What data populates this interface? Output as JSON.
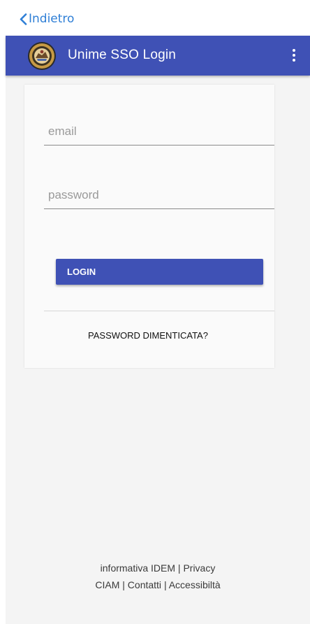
{
  "nav": {
    "back_label": "Indietro",
    "accent": "#2f7fd6"
  },
  "appbar": {
    "title": "Unime SSO Login",
    "background": "#3f51b5",
    "logo_icon": "university-seal-icon",
    "menu_icon": "more-vert-icon"
  },
  "form": {
    "email": {
      "placeholder": "email",
      "value": ""
    },
    "password": {
      "placeholder": "password",
      "value": ""
    },
    "login_label": "LOGIN",
    "forgot_label": "PASSWORD DIMENTICATA?"
  },
  "footer": {
    "idem": "informativa IDEM",
    "privacy": "Privacy",
    "ciam": "CIAM",
    "contacts": "Contatti",
    "accessibility": "Accessibiltà"
  }
}
